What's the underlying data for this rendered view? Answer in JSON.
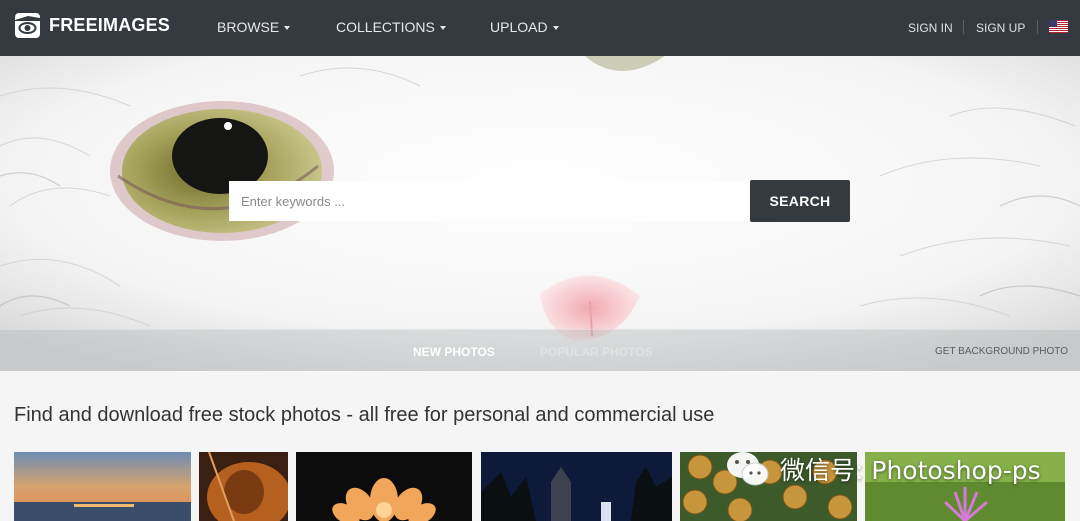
{
  "nav": {
    "logo_text": "FREEIMAGES",
    "menus": [
      {
        "label": "BROWSE"
      },
      {
        "label": "COLLECTIONS"
      },
      {
        "label": "UPLOAD"
      }
    ],
    "sign_in": "SIGN IN",
    "sign_up": "SIGN UP",
    "language_icon": "us-flag-icon"
  },
  "hero": {
    "search": {
      "placeholder": "Enter keywords ...",
      "value": "",
      "button_label": "SEARCH"
    },
    "tabs": [
      {
        "label": "NEW PHOTOS",
        "active": true
      },
      {
        "label": "POPULAR PHOTOS",
        "active": false
      }
    ],
    "get_background_label": "GET BACKGROUND PHOTO"
  },
  "main": {
    "headline": "Find and download free stock photos - all free for personal and commercial use"
  },
  "watermark": {
    "text": "微信号: Photoshop-ps",
    "icon": "wechat-icon"
  },
  "colors": {
    "nav_bg": "#343a40",
    "search_button_bg": "#343a40",
    "page_bg": "#f5f5f5",
    "headline_text": "#333333"
  }
}
